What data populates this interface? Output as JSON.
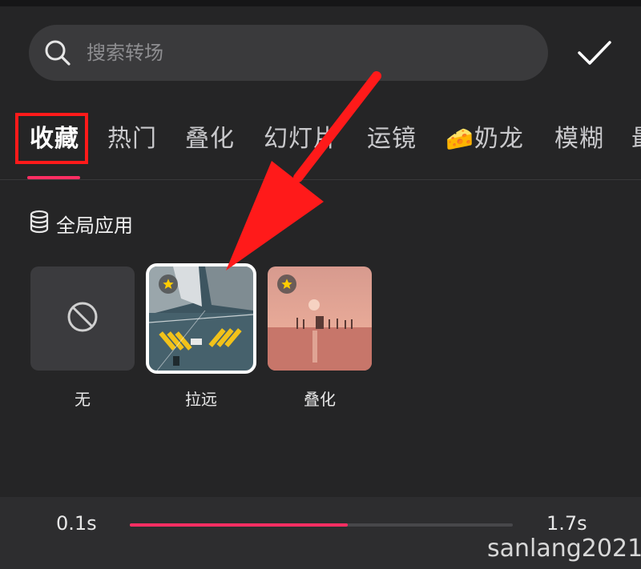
{
  "search": {
    "placeholder": "搜索转场",
    "value": ""
  },
  "tabs": [
    {
      "label": "收藏",
      "active": true
    },
    {
      "label": "热门",
      "active": false
    },
    {
      "label": "叠化",
      "active": false
    },
    {
      "label": "幻灯片",
      "active": false
    },
    {
      "label": "运镜",
      "active": false
    },
    {
      "label": "奶龙",
      "emoji": "🧀",
      "active": false
    },
    {
      "label": "模糊",
      "active": false
    },
    {
      "label": "最",
      "active": false
    }
  ],
  "section": {
    "label": "全局应用",
    "icon": "layers-icon"
  },
  "items": [
    {
      "label": "无",
      "type": "none",
      "icon": "no-entry-icon"
    },
    {
      "label": "拉远",
      "type": "transition",
      "selected": true,
      "favorite": true
    },
    {
      "label": "叠化",
      "type": "transition",
      "favorite": true
    }
  ],
  "duration": {
    "min": "0.1s",
    "max": "1.7s",
    "progress": 0.57
  },
  "watermark": "sanlang2021",
  "colors": {
    "accent": "#ff2e63",
    "annotation": "#ff1a1a",
    "star": "#ffcc00"
  }
}
